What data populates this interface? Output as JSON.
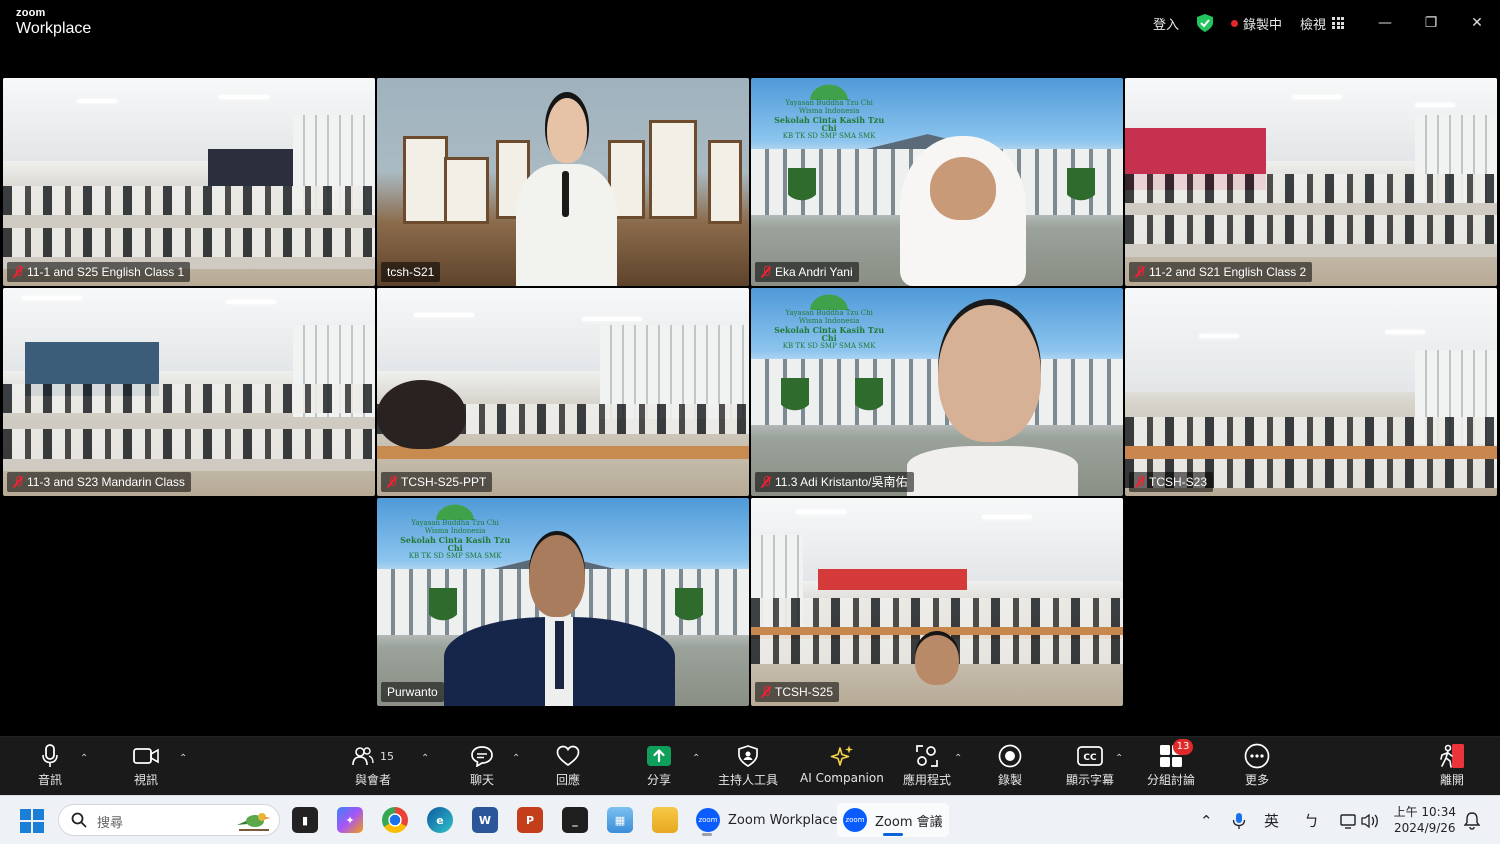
{
  "titlebar": {
    "logo_small": "zoom",
    "logo_big": "Workplace",
    "signin": "登入",
    "recording": "錄製中",
    "view": "檢視",
    "minimize": "—",
    "restore": "❐",
    "close": "✕"
  },
  "tiles": [
    {
      "name": "11-1 and S25 English Class 1",
      "muted": true
    },
    {
      "name": "tcsh-S21",
      "muted": false,
      "active": true
    },
    {
      "name": "Eka Andri Yani",
      "muted": true
    },
    {
      "name": "11-2 and S21 English Class 2",
      "muted": true
    },
    {
      "name": "11-3 and S23 Mandarin Class",
      "muted": true
    },
    {
      "name": "TCSH-S25-PPT",
      "muted": true
    },
    {
      "name": "11.3 Adi Kristanto/吳南佑",
      "muted": true
    },
    {
      "name": "TCSH-S23",
      "muted": true
    },
    {
      "name": "Purwanto",
      "muted": false
    },
    {
      "name": "TCSH-S25",
      "muted": true
    }
  ],
  "school_sign": {
    "line1": "Yayasan Buddha Tzu Chi Wisma Indonesia",
    "line2": "Sekolah Cinta Kasih Tzu Chi",
    "line3": "KB TK SD SMP SMA SMK"
  },
  "toolbar": {
    "audio": "音訊",
    "video": "視訊",
    "participants": "與會者",
    "participants_count": "15",
    "chat": "聊天",
    "react": "回應",
    "share": "分享",
    "host_tools": "主持人工具",
    "ai": "AI Companion",
    "apps": "應用程式",
    "record": "錄製",
    "captions": "顯示字幕",
    "breakout": "分組討論",
    "breakout_badge": "13",
    "more": "更多",
    "leave": "離開"
  },
  "taskbar": {
    "search_placeholder": "搜尋",
    "zoom_workplace": "Zoom Workplace",
    "zoom_meeting": "Zoom 會議",
    "ime": "英",
    "ime2": "ㄅ",
    "time": "上午 10:34",
    "date": "2024/9/26"
  },
  "colors": {
    "active_border": "#2fd665",
    "record": "#e02828",
    "share": "#0e9f5a",
    "zoom_blue": "#0b5cff",
    "badge": "#e02a2a"
  }
}
